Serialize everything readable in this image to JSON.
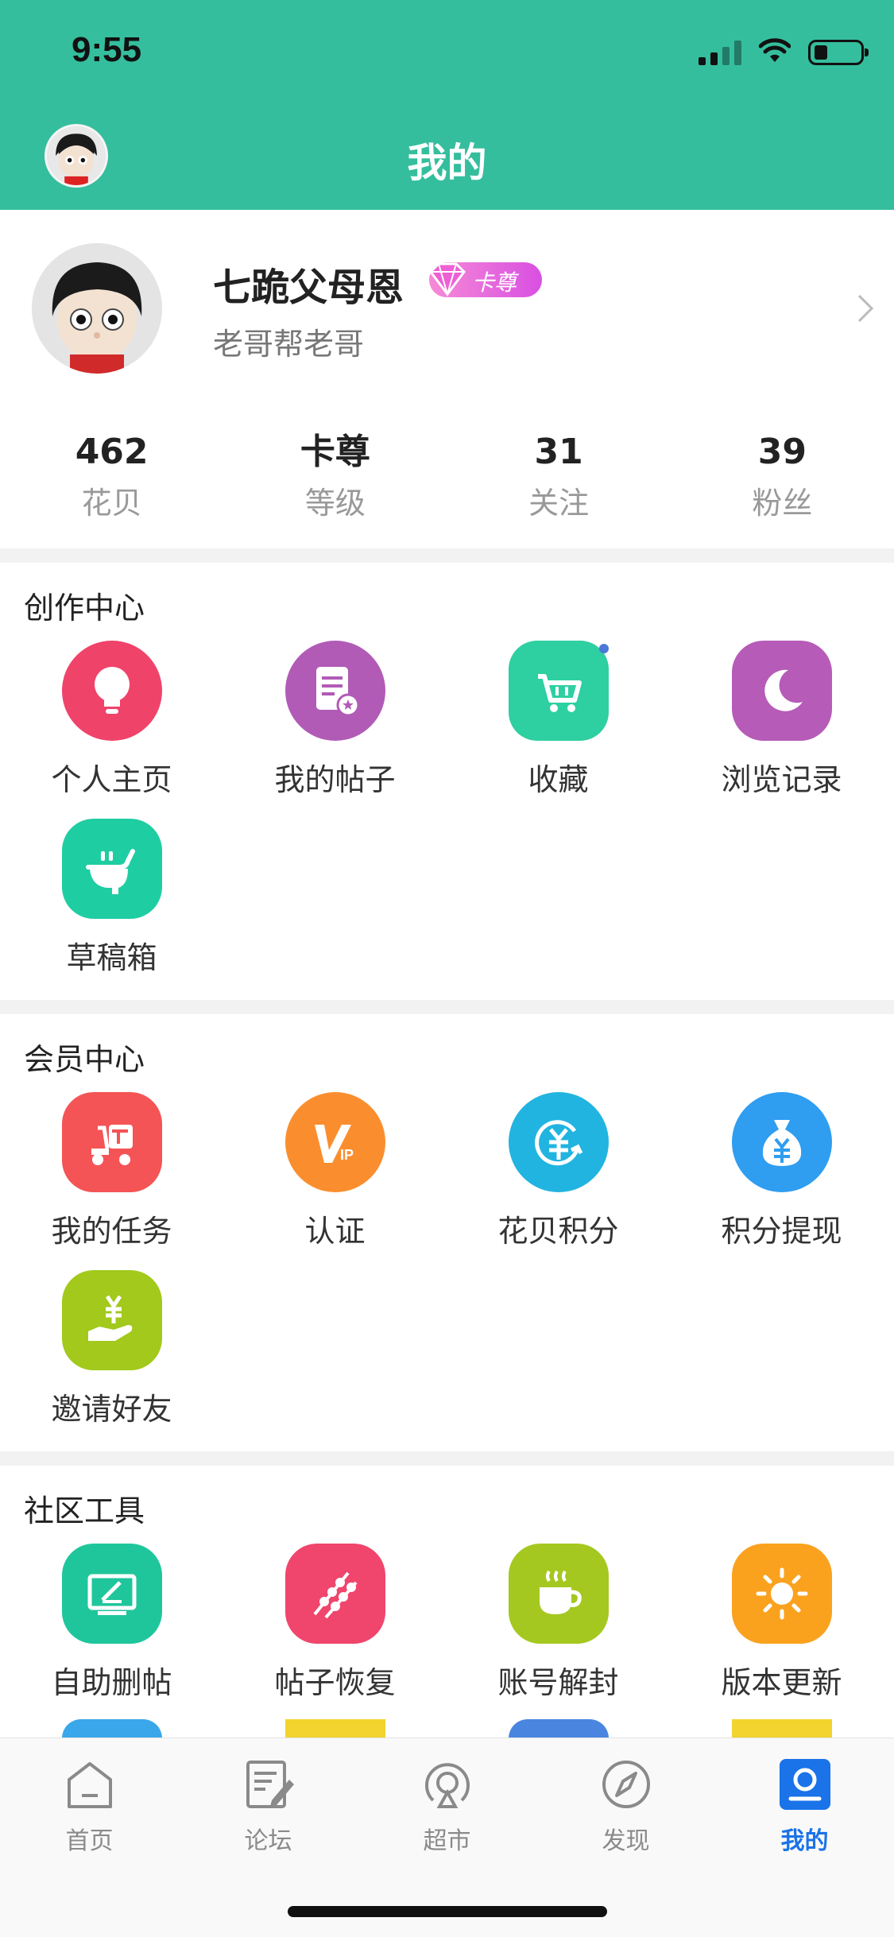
{
  "status": {
    "time": "9:55"
  },
  "header": {
    "title": "我的"
  },
  "profile": {
    "nickname": "七跪父母恩",
    "badge": "卡尊",
    "signature": "老哥帮老哥",
    "stats": [
      {
        "value": "462",
        "label": "花贝"
      },
      {
        "value": "卡尊",
        "label": "等级"
      },
      {
        "value": "31",
        "label": "关注"
      },
      {
        "value": "39",
        "label": "粉丝"
      }
    ]
  },
  "sections": {
    "creation": {
      "title": "创作中心",
      "items": [
        {
          "label": "个人主页",
          "icon": "lightbulb-icon",
          "color": "#f0436a"
        },
        {
          "label": "我的帖子",
          "icon": "document-icon",
          "color": "#b15bb7"
        },
        {
          "label": "收藏",
          "icon": "shopping-cart-icon",
          "color": "#2ecfa1"
        },
        {
          "label": "浏览记录",
          "icon": "moon-icon",
          "color": "#b65bb8"
        },
        {
          "label": "草稿箱",
          "icon": "draft-icon",
          "color": "#1fcda3"
        }
      ]
    },
    "member": {
      "title": "会员中心",
      "items": [
        {
          "label": "我的任务",
          "icon": "scooter-icon",
          "color": "#f45455"
        },
        {
          "label": "认证",
          "icon": "vip-icon",
          "color": "#fa8e2e"
        },
        {
          "label": "花贝积分",
          "icon": "yen-circle-icon",
          "color": "#22b4e0"
        },
        {
          "label": "积分提现",
          "icon": "money-bag-icon",
          "color": "#2f9df0"
        },
        {
          "label": "邀请好友",
          "icon": "yen-hand-icon",
          "color": "#a2c91c"
        }
      ]
    },
    "tools": {
      "title": "社区工具",
      "items": [
        {
          "label": "自助删帖",
          "icon": "monitor-edit-icon",
          "color": "#1fc69c"
        },
        {
          "label": "帖子恢复",
          "icon": "skewers-icon",
          "color": "#f0456c"
        },
        {
          "label": "账号解封",
          "icon": "coffee-cup-icon",
          "color": "#a5c820"
        },
        {
          "label": "版本更新",
          "icon": "sun-icon",
          "color": "#faa21e"
        }
      ]
    }
  },
  "tabbar": {
    "items": [
      {
        "label": "首页",
        "icon": "home-icon"
      },
      {
        "label": "论坛",
        "icon": "forum-icon"
      },
      {
        "label": "超市",
        "icon": "market-icon"
      },
      {
        "label": "发现",
        "icon": "compass-icon"
      },
      {
        "label": "我的",
        "icon": "profile-icon",
        "active": true
      }
    ]
  },
  "colors": {
    "brand": "#35be9d",
    "tab_active": "#1a73e8"
  }
}
